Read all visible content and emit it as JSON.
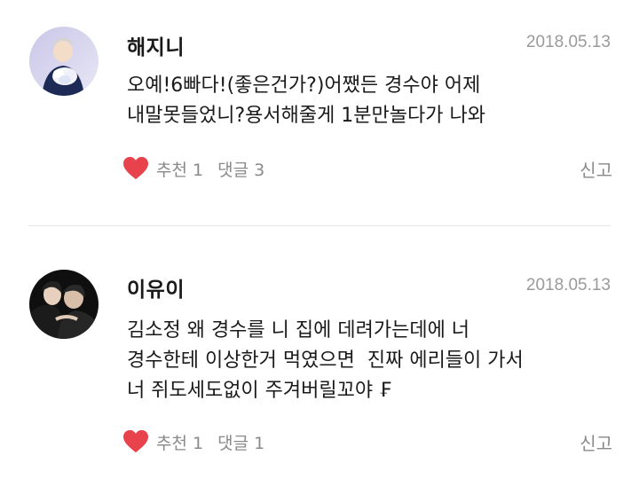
{
  "comments": [
    {
      "author": "해지니",
      "date": "2018.05.13",
      "lines": [
        "오예!6빠다!(좋은건가?)어쨌든 경수야 어제",
        "내말못들었니?용서해줄게 1분만놀다가 나와"
      ],
      "like_label": "추천 1",
      "reply_label": "댓글 3",
      "report_label": "신고"
    },
    {
      "author": "이유이",
      "date": "2018.05.13",
      "lines": [
        "김소정 왜 경수를 니 집에 데려가는데에 너",
        "경수한테 이상한거 먹였으면  진짜 에리들이 가서",
        "너 쥐도세도없이 주겨버릴꼬야 ₣"
      ],
      "like_label": "추천 1",
      "reply_label": "댓글 1",
      "report_label": "신고"
    }
  ],
  "colors": {
    "heart": "#e8424c",
    "meta": "#8a8a8a",
    "date": "#9a9a9a",
    "divider": "#e6e6e6"
  },
  "icons": {
    "like": "heart-icon"
  }
}
